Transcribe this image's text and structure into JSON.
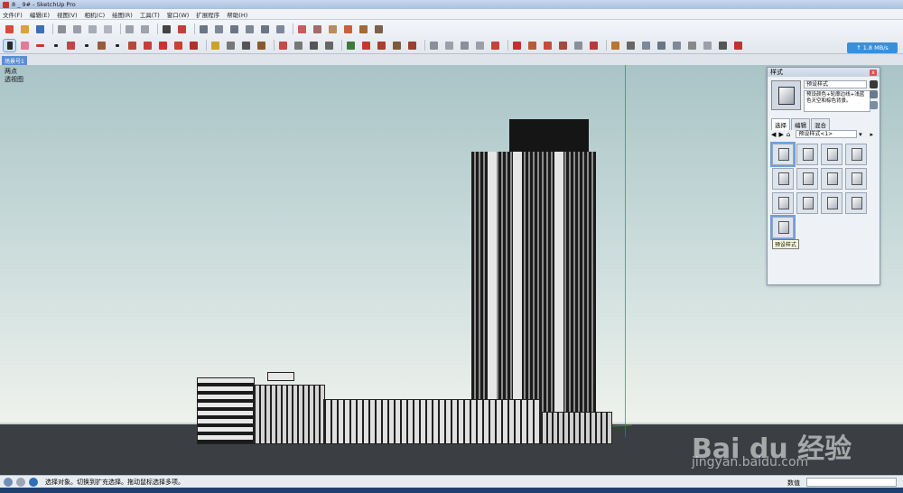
{
  "window": {
    "title": "8 _ 9# - SketchUp Pro"
  },
  "menu": [
    "文件(F)",
    "编辑(E)",
    "视图(V)",
    "相机(C)",
    "绘图(R)",
    "工具(T)",
    "窗口(W)",
    "扩展程序",
    "帮助(H)"
  ],
  "toolbar": {
    "network_speed": "↑ 1.8 MB/s"
  },
  "scene_tab": "场景号1",
  "viewport": {
    "label_view": "两点",
    "label_projection": "透视图"
  },
  "styles_panel": {
    "title": "样式",
    "close_label": "x",
    "style_name": "预设样式",
    "style_desc": "预设颜色+轮廓边线+浅蓝色天空和棕色背景。",
    "tabs": [
      "选择",
      "编辑",
      "混合"
    ],
    "collection": "预设样式<1>",
    "tooltip": "预设样式"
  },
  "status": {
    "message": "选择对象。切换到扩充选择。拖动鼠标选择多项。",
    "measure_label": "数值"
  },
  "watermark": {
    "logo": "Bai du 经验",
    "url": "jingyan.baidu.com"
  },
  "colors": {
    "accent": "#3b8fd8",
    "axis_blue": "#4b64d6",
    "axis_green": "#2ca02c"
  }
}
